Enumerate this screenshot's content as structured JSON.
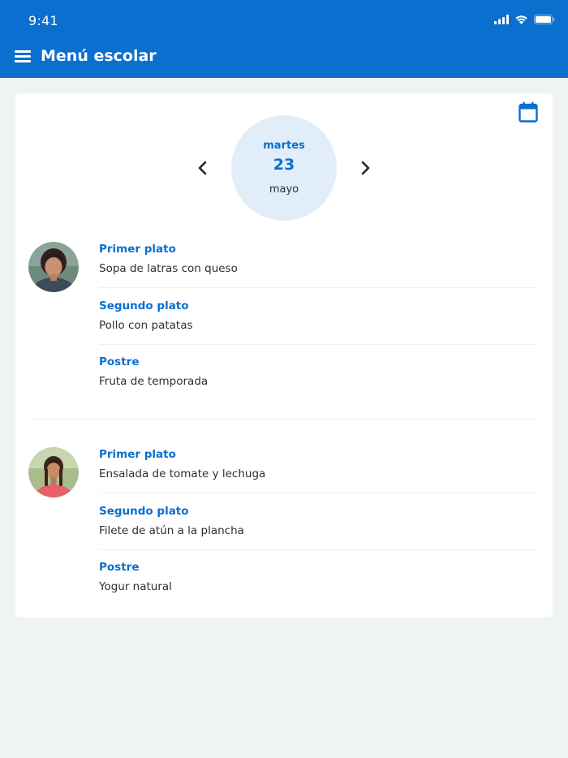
{
  "status_bar": {
    "time": "9:41"
  },
  "header": {
    "title": "Menú escolar"
  },
  "date": {
    "weekday": "martes",
    "day": "23",
    "month": "mayo"
  },
  "colors": {
    "primary": "#0a6fcf",
    "circle": "#e1eef9",
    "background": "#eff4f3"
  },
  "icons": {
    "menu": "hamburger-icon",
    "calendar": "calendar-icon",
    "prev": "chevron-left-icon",
    "next": "chevron-right-icon"
  },
  "kids": [
    {
      "courses": [
        {
          "label": "Primer plato",
          "dish": "Sopa de latras con queso"
        },
        {
          "label": "Segundo plato",
          "dish": "Pollo con patatas"
        },
        {
          "label": "Postre",
          "dish": "Fruta de temporada"
        }
      ]
    },
    {
      "courses": [
        {
          "label": "Primer plato",
          "dish": "Ensalada de tomate y lechuga"
        },
        {
          "label": "Segundo plato",
          "dish": "Filete de atún a la plancha"
        },
        {
          "label": "Postre",
          "dish": "Yogur natural"
        }
      ]
    }
  ]
}
